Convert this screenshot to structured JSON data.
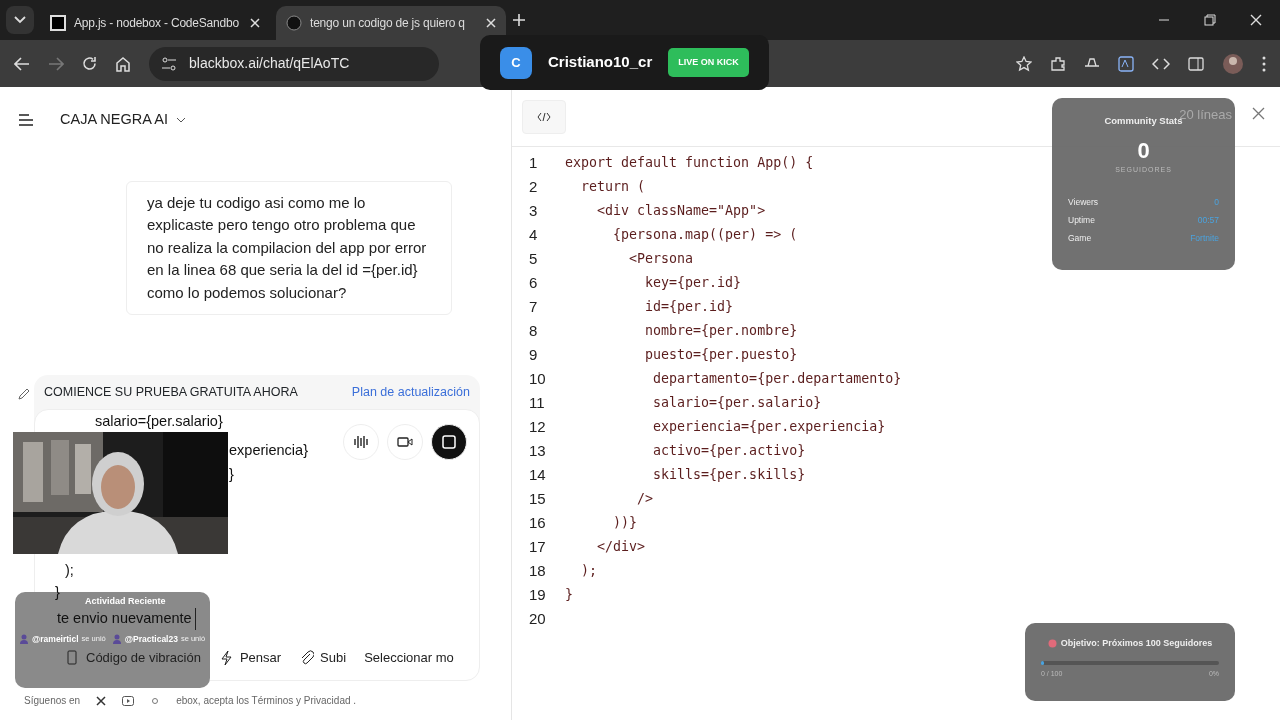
{
  "browser": {
    "tabs": [
      {
        "title": "App.js - nodebox - CodeSandbo",
        "selected": false
      },
      {
        "title": "tengo un codigo de js quiero q",
        "selected": true
      }
    ],
    "url": "blackbox.ai/chat/qElAoTC"
  },
  "stream_banner": {
    "avatar_letter": "C",
    "channel": "Cristiano10_cr",
    "badge": "LIVE ON KICK"
  },
  "chat": {
    "brand": "CAJA NEGRA AI",
    "message": "ya deje tu codigo asi como me lo explicaste pero tengo otro problema que no realiza la compilacion del app por error en la linea 68 que seria la del id ={per.id} como lo podemos solucionar?",
    "promo": "COMIENCE SU PRUEBA GRATUITA AHORA",
    "upgrade_link": "Plan de actualización",
    "input_lines": [
      "salario={per.salario}",
      "experiencia}",
      "}",
      ");",
      "}"
    ],
    "input_value": "te envio nuevamente",
    "tools": [
      "Código de vibración",
      "Pensar",
      "Subi",
      "Seleccionar mo"
    ],
    "footer_left": "Síguenos en",
    "footer_right": "ebox, acepta los Términos y Privacidad ."
  },
  "code_panel": {
    "line_count": "20 líneas",
    "lines": [
      {
        "number": "1",
        "code": "export default function App() {"
      },
      {
        "number": "2",
        "code": "  return ("
      },
      {
        "number": "3",
        "code": "    <div className=\"App\">"
      },
      {
        "number": "4",
        "code": "      {persona.map((per) => ("
      },
      {
        "number": "5",
        "code": "        <Persona"
      },
      {
        "number": "6",
        "code": "          key={per.id}"
      },
      {
        "number": "7",
        "code": "          id={per.id}"
      },
      {
        "number": "8",
        "code": "          nombre={per.nombre}"
      },
      {
        "number": "9",
        "code": "          puesto={per.puesto}"
      },
      {
        "number": "10",
        "code": "           departamento={per.departamento}"
      },
      {
        "number": "11",
        "code": "           salario={per.salario}"
      },
      {
        "number": "12",
        "code": "           experiencia={per.experiencia}"
      },
      {
        "number": "13",
        "code": "           activo={per.activo}"
      },
      {
        "number": "14",
        "code": "           skills={per.skills}"
      },
      {
        "number": "15",
        "code": "         />"
      },
      {
        "number": "16",
        "code": "      ))}"
      },
      {
        "number": "17",
        "code": "    </div>"
      },
      {
        "number": "18",
        "code": "  );"
      },
      {
        "number": "19",
        "code": "}"
      },
      {
        "number": "20"
      }
    ]
  },
  "community_stats": {
    "title": "Community Stats",
    "count": "0",
    "count_label": "SEGUIDORES",
    "rows": [
      {
        "label": "Viewers",
        "value": "0"
      },
      {
        "label": "Uptime",
        "value": "00:57"
      },
      {
        "label": "Game",
        "value": "Fortnite"
      }
    ]
  },
  "recent_activity": {
    "title": "Actividad Reciente",
    "items": [
      {
        "user": "@rameirticl",
        "note": "se unió"
      },
      {
        "user": "@Practical23",
        "note": "se unió"
      }
    ]
  },
  "goal": {
    "title": "Objetivo: Próximos 100 Seguidores",
    "progress": "0 / 100",
    "percent": "0%",
    "level": 0
  }
}
